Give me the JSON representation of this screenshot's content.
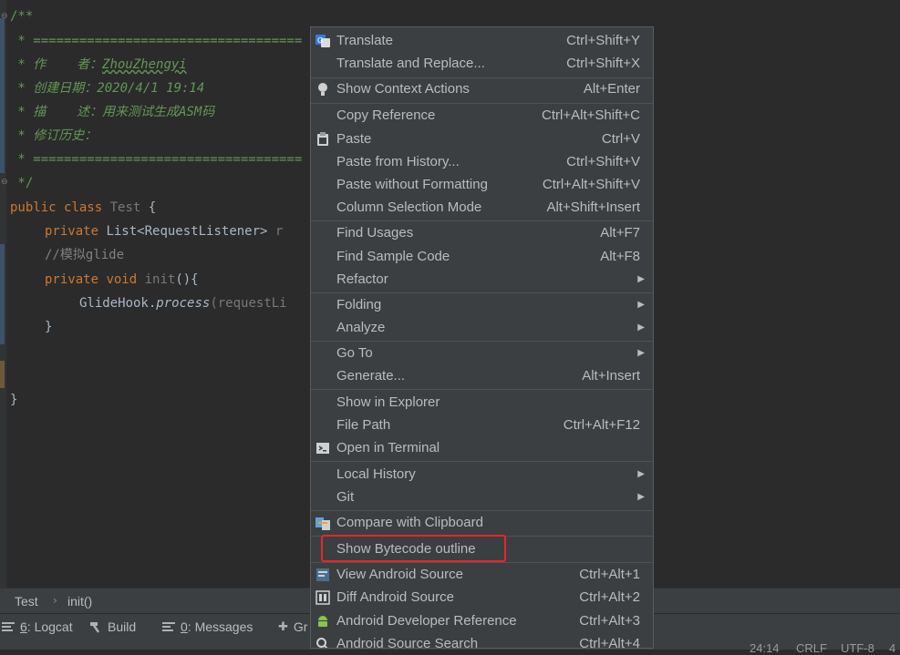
{
  "editor": {
    "lines": [
      {
        "t": "/**"
      },
      {
        "t": " * ==================================="
      },
      {
        "t": " * 作    者：",
        "u": "ZhouZhengyi"
      },
      {
        "t": " * 创建日期：2020/4/1 19:14"
      },
      {
        "t": " * 描    述：用来测试生成ASM码"
      },
      {
        "t": " * 修订历史："
      },
      {
        "t": " * ==================================="
      },
      {
        "t": " */"
      }
    ],
    "code": {
      "kw_public": "public",
      "kw_class": "class",
      "class_name": "Test",
      "brace_open": " {",
      "kw_private": "private",
      "field_type": "List<RequestListener>",
      "field_rest": " r",
      "comment": "//模拟glide",
      "kw_private2": "private",
      "kw_void": "void",
      "method_name": "init",
      "method_sig": "(){",
      "call_obj": "GlideHook.",
      "call_method": "process",
      "call_args": "(requestLi",
      "close_inner": "}",
      "close_outer": "}"
    }
  },
  "breadcrumb": {
    "class": "Test",
    "sep": "›",
    "method": "init()"
  },
  "toolwindows": [
    {
      "id": "6",
      "label": ": Logcat",
      "icon": "logcat-icon"
    },
    {
      "id": "",
      "label": "Build",
      "icon": "hammer-icon"
    },
    {
      "id": "0",
      "label": ": Messages",
      "icon": "messages-icon"
    },
    {
      "id": "",
      "label": "Gr",
      "icon": "plus-icon"
    }
  ],
  "status": {
    "position": "24:14",
    "line_sep": "CRLF",
    "encoding": "UTF-8",
    "extra": "4"
  },
  "menu": {
    "items": [
      {
        "label": "Translate",
        "shortcut": "Ctrl+Shift+Y",
        "icon": "translate-icon"
      },
      {
        "label": "Translate and Replace...",
        "shortcut": "Ctrl+Shift+X"
      },
      {
        "sep": true
      },
      {
        "label": "Show Context Actions",
        "shortcut": "Alt+Enter",
        "icon": "bulb-icon"
      },
      {
        "sep": true
      },
      {
        "label": "Copy Reference",
        "shortcut": "Ctrl+Alt+Shift+C"
      },
      {
        "label": "Paste",
        "shortcut": "Ctrl+V",
        "icon": "clipboard-icon"
      },
      {
        "label": "Paste from History...",
        "shortcut": "Ctrl+Shift+V"
      },
      {
        "label": "Paste without Formatting",
        "shortcut": "Ctrl+Alt+Shift+V"
      },
      {
        "label": "Column Selection Mode",
        "shortcut": "Alt+Shift+Insert"
      },
      {
        "sep": true
      },
      {
        "label": "Find Usages",
        "shortcut": "Alt+F7"
      },
      {
        "label": "Find Sample Code",
        "shortcut": "Alt+F8"
      },
      {
        "label": "Refactor",
        "submenu": true
      },
      {
        "sep": true
      },
      {
        "label": "Folding",
        "submenu": true
      },
      {
        "label": "Analyze",
        "submenu": true
      },
      {
        "sep": true
      },
      {
        "label": "Go To",
        "submenu": true
      },
      {
        "label": "Generate...",
        "shortcut": "Alt+Insert"
      },
      {
        "sep": true
      },
      {
        "label": "Show in Explorer"
      },
      {
        "label": "File Path",
        "shortcut": "Ctrl+Alt+F12"
      },
      {
        "label": "Open in Terminal",
        "icon": "terminal-icon"
      },
      {
        "sep": true
      },
      {
        "label": "Local History",
        "submenu": true
      },
      {
        "label": "Git",
        "submenu": true
      },
      {
        "sep": true
      },
      {
        "label": "Compare with Clipboard",
        "icon": "compare-icon"
      },
      {
        "sep": true
      },
      {
        "label": "Show Bytecode outline"
      },
      {
        "sep": true
      },
      {
        "label": "View Android Source",
        "shortcut": "Ctrl+Alt+1",
        "icon": "android-source-icon"
      },
      {
        "label": "Diff Android Source",
        "shortcut": "Ctrl+Alt+2",
        "icon": "diff-icon"
      },
      {
        "label": "Android Developer Reference",
        "shortcut": "Ctrl+Alt+3",
        "icon": "android-icon"
      },
      {
        "label": "Android Source Search",
        "shortcut": "Ctrl+Alt+4",
        "icon": "search-icon"
      }
    ]
  }
}
